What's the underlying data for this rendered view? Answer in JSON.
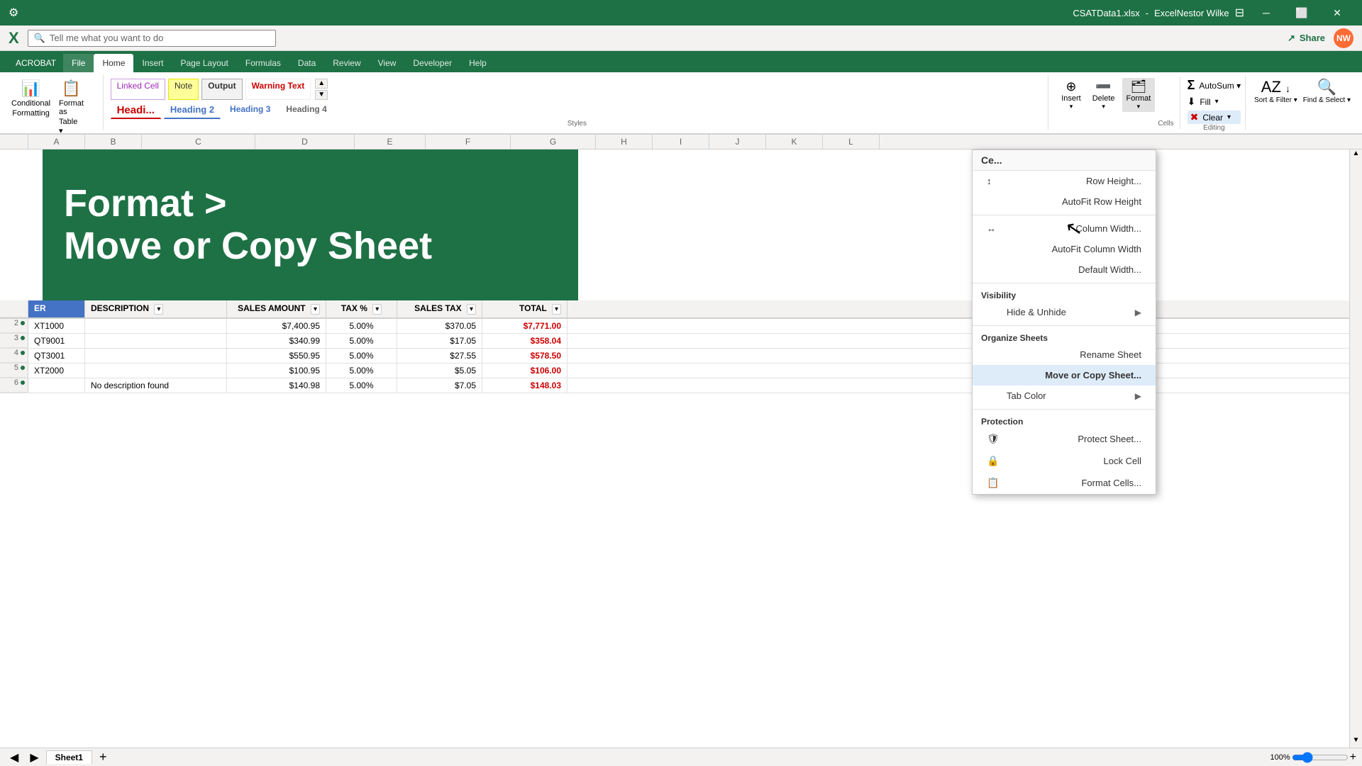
{
  "titleBar": {
    "filename": "CSATData1.xlsx",
    "appName": "Excel",
    "userName": "Nestor Wilke",
    "userInitials": "NW"
  },
  "ribbonBar": {
    "searchPlaceholder": "Tell me what you want to do",
    "shareLabel": "Share"
  },
  "ribbonTabs": {
    "acrobat": "ACROBAT",
    "items": [
      "File",
      "Home",
      "Insert",
      "Page Layout",
      "Formulas",
      "Data",
      "Review",
      "View",
      "Developer",
      "Help"
    ]
  },
  "styles": {
    "row1": [
      {
        "label": "Linked Cell",
        "class": "style-linked"
      },
      {
        "label": "Note",
        "class": "style-note"
      },
      {
        "label": "Output",
        "class": "style-output"
      },
      {
        "label": "Warning Text",
        "class": "style-warning"
      }
    ],
    "row2": [
      {
        "label": "Headi...",
        "class": "style-heading1"
      },
      {
        "label": "Heading 2",
        "class": "style-heading2"
      },
      {
        "label": "Heading 3",
        "class": "style-heading3"
      },
      {
        "label": "Heading 4",
        "class": "style-heading4"
      }
    ]
  },
  "cells": {
    "insert": "Insert",
    "delete": "Delete",
    "format": "Format",
    "sectionLabel": "Cells"
  },
  "editing": {
    "autoSum": "AutoSum",
    "fill": "Fill",
    "clear": "Clear",
    "sortFilter": "Sort & Find &\nFilter  Select",
    "sectionLabel": ""
  },
  "greenOverlay": {
    "line1": "Format >",
    "line2": "Move or Copy Sheet"
  },
  "tableHeaders": {
    "er": "ER",
    "description": "DESCRIPTION",
    "salesAmount": "SALES AMOUNT",
    "taxPct": "TAX %",
    "salesTax": "SALES TAX",
    "total": "TOTAL"
  },
  "tableData": [
    {
      "er": "XT1000",
      "desc": "",
      "sales": "$7,400.95",
      "tax": "5.00%",
      "salesTax": "$370.05",
      "total": "$7,771.00"
    },
    {
      "er": "QT9001",
      "desc": "",
      "sales": "$340.99",
      "tax": "5.00%",
      "salesTax": "$17.05",
      "total": "$358.04"
    },
    {
      "er": "QT3001",
      "desc": "",
      "sales": "$550.95",
      "tax": "5.00%",
      "salesTax": "$27.55",
      "total": "$578.50"
    },
    {
      "er": "XT2000",
      "desc": "",
      "sales": "$100.95",
      "tax": "5.00%",
      "salesTax": "$5.05",
      "total": "$106.00"
    },
    {
      "er": "",
      "desc": "No description found",
      "sales": "$140.98",
      "tax": "5.00%",
      "salesTax": "$7.05",
      "total": "$148.03"
    }
  ],
  "dropdownMenu": {
    "resizeHeader": "Ce...",
    "rowHeight": "Row Height...",
    "autoFitRowHeight": "AutoFit Row Height",
    "columnWidth": "Column Width...",
    "autoFitColumnWidth": "AutoFit Column Width",
    "defaultWidth": "Default Width...",
    "visibilityLabel": "Visibility",
    "hideUnhide": "Hide & Unhide",
    "organizeSheetsLabel": "Organize Sheets",
    "renameSheet": "Rename Sheet",
    "moveOrCopySheet": "Move or Copy Sheet...",
    "tabColor": "Tab Color",
    "protectionLabel": "Protection",
    "protectSheet": "Protect Sheet...",
    "lockCell": "Lock Cell",
    "formatCells": "Format Cells..."
  },
  "icons": {
    "search": "🔍",
    "share": "↗",
    "rowHeight": "↕",
    "columnWidth": "↔",
    "hideUnhide": "▶",
    "tabColor": "▶",
    "lockCell": "🔒",
    "protectSheet": "🛡",
    "formatCells": "📋",
    "autoSum": "Σ",
    "fill": "⬇",
    "clear": "✖",
    "sortFilter": "↕",
    "findSelect": "🔍"
  }
}
